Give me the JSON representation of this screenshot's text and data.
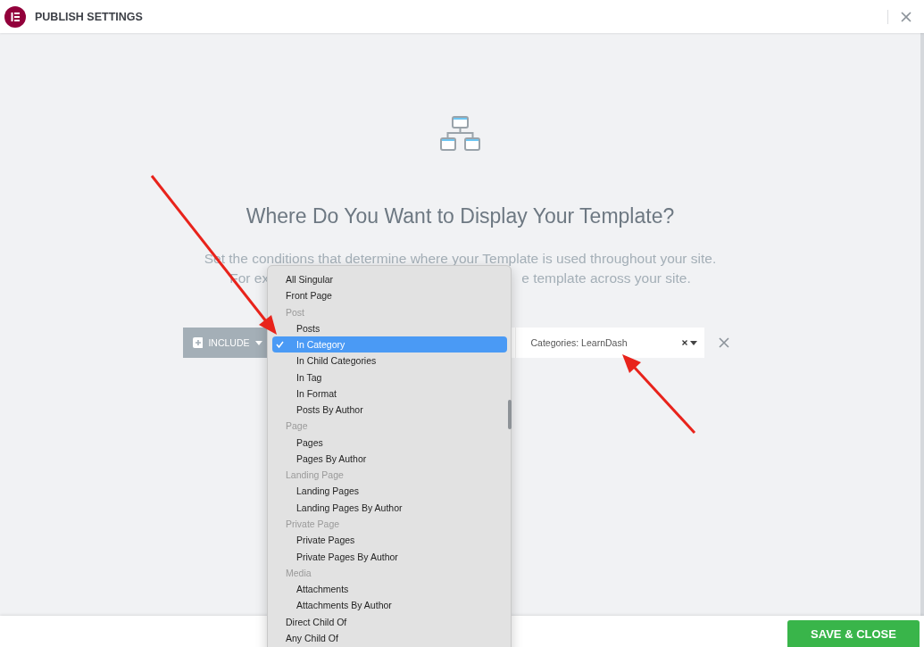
{
  "header": {
    "title": "PUBLISH SETTINGS"
  },
  "intro": {
    "heading": "Where Do You Want to Display Your Template?",
    "line_1": "Set the conditions that determine where your Template is used throughout your site.",
    "line_2_start": "For ex",
    "line_2_end": "e template across your site."
  },
  "condition": {
    "type_button": "INCLUDE",
    "value": "Categories: LearnDash"
  },
  "dropdown": {
    "items": [
      {
        "kind": "option",
        "label": "All Singular",
        "selected": false
      },
      {
        "kind": "option",
        "label": "Front Page",
        "selected": false
      },
      {
        "kind": "group",
        "label": "Post",
        "children": [
          {
            "kind": "option",
            "label": "Posts",
            "selected": false
          },
          {
            "kind": "option",
            "label": "In Category",
            "selected": true
          },
          {
            "kind": "option",
            "label": "In Child Categories",
            "selected": false
          },
          {
            "kind": "option",
            "label": "In Tag",
            "selected": false
          },
          {
            "kind": "option",
            "label": "In Format",
            "selected": false
          },
          {
            "kind": "option",
            "label": "Posts By Author",
            "selected": false
          }
        ]
      },
      {
        "kind": "group",
        "label": "Page",
        "children": [
          {
            "kind": "option",
            "label": "Pages",
            "selected": false
          },
          {
            "kind": "option",
            "label": "Pages By Author",
            "selected": false
          }
        ]
      },
      {
        "kind": "group",
        "label": "Landing Page",
        "children": [
          {
            "kind": "option",
            "label": "Landing Pages",
            "selected": false
          },
          {
            "kind": "option",
            "label": "Landing Pages By Author",
            "selected": false
          }
        ]
      },
      {
        "kind": "group",
        "label": "Private Page",
        "children": [
          {
            "kind": "option",
            "label": "Private Pages",
            "selected": false
          },
          {
            "kind": "option",
            "label": "Private Pages By Author",
            "selected": false
          }
        ]
      },
      {
        "kind": "group",
        "label": "Media",
        "children": [
          {
            "kind": "option",
            "label": "Attachments",
            "selected": false
          },
          {
            "kind": "option",
            "label": "Attachments By Author",
            "selected": false
          }
        ]
      },
      {
        "kind": "option",
        "label": "Direct Child Of",
        "selected": false
      },
      {
        "kind": "option",
        "label": "Any Child Of",
        "selected": false
      }
    ]
  },
  "footer": {
    "save_button": "SAVE & CLOSE"
  }
}
